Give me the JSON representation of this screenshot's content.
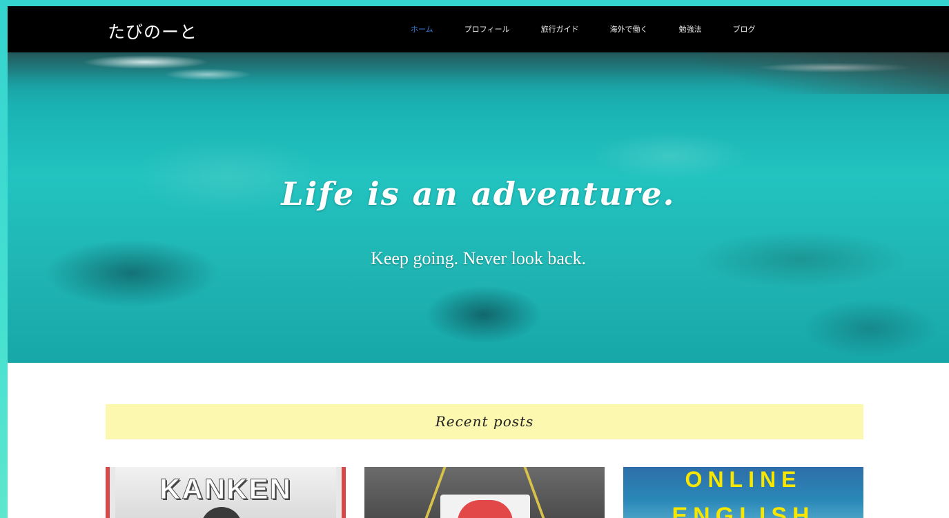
{
  "header": {
    "logo": "たびのーと",
    "nav": [
      {
        "label": "ホーム",
        "active": true
      },
      {
        "label": "プロフィール",
        "active": false
      },
      {
        "label": "旅行ガイド",
        "active": false
      },
      {
        "label": "海外で働く",
        "active": false
      },
      {
        "label": "勉強法",
        "active": false
      },
      {
        "label": "ブログ",
        "active": false
      }
    ]
  },
  "hero": {
    "title": "Life is an adventure.",
    "subtitle": "Keep going. Never look back."
  },
  "recent": {
    "title": "Recent posts",
    "cards": [
      {
        "title": "KANKEN"
      },
      {
        "title": ""
      },
      {
        "title_line1": "ONLINE",
        "title_line2": "ENGLISH"
      }
    ]
  },
  "colors": {
    "outer_background": "#35d3cf",
    "header_background": "#000000",
    "active_nav": "#3a7bd5",
    "recent_bar": "#fdf8b0"
  }
}
